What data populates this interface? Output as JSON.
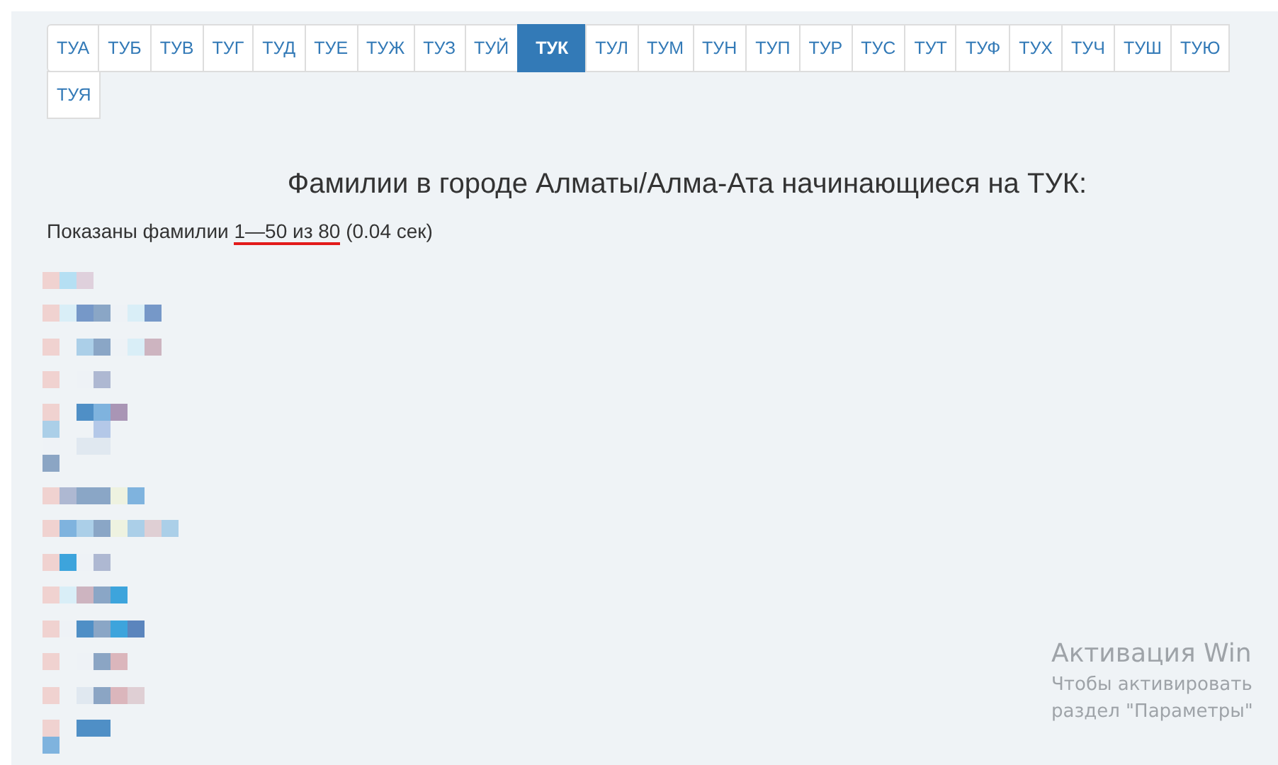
{
  "pagination": [
    {
      "label": "ТУА",
      "selected": false
    },
    {
      "label": "ТУБ",
      "selected": false
    },
    {
      "label": "ТУВ",
      "selected": false
    },
    {
      "label": "ТУГ",
      "selected": false
    },
    {
      "label": "ТУД",
      "selected": false
    },
    {
      "label": "ТУЕ",
      "selected": false
    },
    {
      "label": "ТУЖ",
      "selected": false
    },
    {
      "label": "ТУЗ",
      "selected": false
    },
    {
      "label": "ТУЙ",
      "selected": false
    },
    {
      "label": "ТУК",
      "selected": true
    },
    {
      "label": "ТУЛ",
      "selected": false
    },
    {
      "label": "ТУМ",
      "selected": false
    },
    {
      "label": "ТУН",
      "selected": false
    },
    {
      "label": "ТУП",
      "selected": false
    },
    {
      "label": "ТУР",
      "selected": false
    },
    {
      "label": "ТУС",
      "selected": false
    },
    {
      "label": "ТУТ",
      "selected": false
    },
    {
      "label": "ТУФ",
      "selected": false
    },
    {
      "label": "ТУХ",
      "selected": false
    },
    {
      "label": "ТУЧ",
      "selected": false
    },
    {
      "label": "ТУШ",
      "selected": false
    },
    {
      "label": "ТУЮ",
      "selected": false
    },
    {
      "label": "ТУЯ",
      "selected": false
    }
  ],
  "heading": "Фамилии в городе Алматы/Алма-Ата начинающиеся на ТУК:",
  "summary": {
    "before": "Показаны фамилии ",
    "marked": "1—50 из 80",
    "after": " (0.04 сек)",
    "marked_underlined": true
  },
  "activation_notice": {
    "title": "Активация Win",
    "lines": [
      "Чтобы активировать",
      "раздел \"Параметры\""
    ]
  }
}
